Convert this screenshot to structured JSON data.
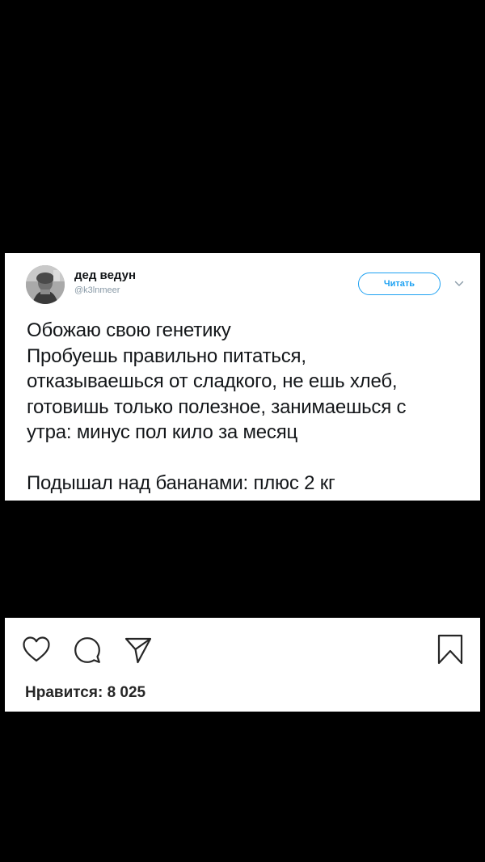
{
  "tweet": {
    "display_name": "дед ведун",
    "handle": "@k3lnmeer",
    "follow_label": "Читать",
    "text_lines": [
      "Обожаю свою генетику",
      "Пробуешь правильно питаться,",
      "отказываешься от сладкого, не ешь хлеб,",
      "готовишь только полезное, занимаешься с",
      "утра: минус пол кило за месяц"
    ],
    "punchline": "Подышал над бананами: плюс 2 кг",
    "icons": {
      "avatar": "avatar",
      "more": "chevron-down-icon"
    },
    "colors": {
      "accent": "#1da1f2",
      "text": "#14171a",
      "muted": "#8899a6"
    }
  },
  "instagram": {
    "likes_text": "Нравится: 8 025",
    "icons": [
      "heart-icon",
      "comment-icon",
      "share-icon",
      "bookmark-icon"
    ]
  },
  "page": {
    "background": "#000000"
  }
}
